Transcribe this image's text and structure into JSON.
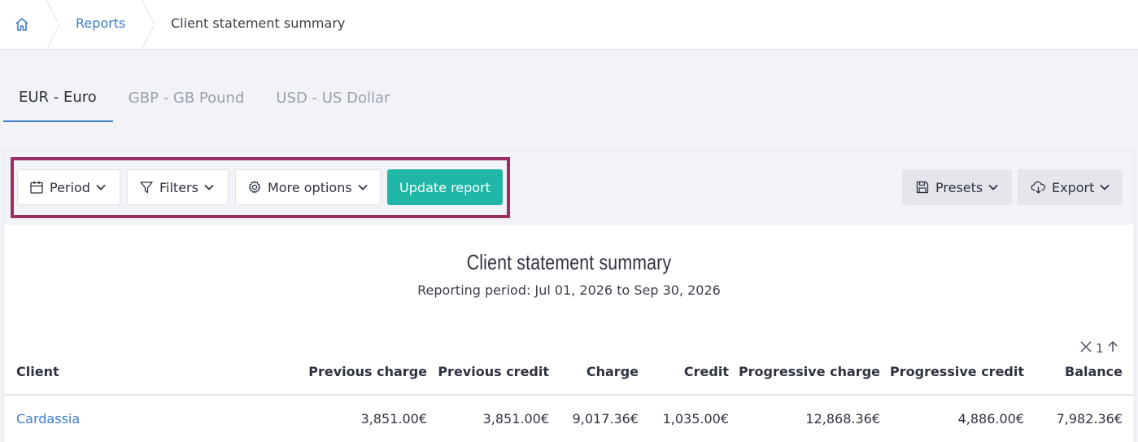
{
  "breadcrumb": {
    "home_icon": "home-icon",
    "items": [
      "Reports",
      "Client statement summary"
    ]
  },
  "tabs": [
    {
      "label": "EUR - Euro",
      "active": true
    },
    {
      "label": "GBP - GB Pound",
      "active": false
    },
    {
      "label": "USD - US Dollar",
      "active": false
    }
  ],
  "toolbar": {
    "period_label": "Period",
    "filters_label": "Filters",
    "more_options_label": "More options",
    "update_label": "Update report",
    "presets_label": "Presets",
    "export_label": "Export"
  },
  "report": {
    "title": "Client statement summary",
    "period": "Reporting period: Jul 01, 2026 to Sep 30, 2026",
    "sort_count": "1"
  },
  "table": {
    "columns": [
      "Client",
      "Previous charge",
      "Previous credit",
      "Charge",
      "Credit",
      "Progressive charge",
      "Progressive credit",
      "Balance"
    ],
    "rows": [
      [
        "Cardassia",
        "3,851.00€",
        "3,851.00€",
        "9,017.36€",
        "1,035.00€",
        "12,868.36€",
        "4,886.00€",
        "7,982.36€"
      ]
    ]
  },
  "colors": {
    "accent": "#3d7dca",
    "primary_button": "#20b7a7",
    "highlight_border": "#9c2f62"
  }
}
